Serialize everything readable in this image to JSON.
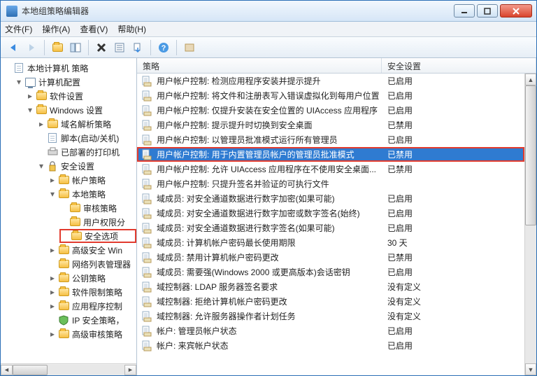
{
  "window": {
    "title": "本地组策略编辑器"
  },
  "menu": {
    "file": "文件(F)",
    "action": "操作(A)",
    "view": "查看(V)",
    "help": "帮助(H)"
  },
  "tree": {
    "root": "本地计算机 策略",
    "computer_config": "计算机配置",
    "software_settings": "软件设置",
    "windows_settings": "Windows 设置",
    "dns_policy": "域名解析策略",
    "scripts": "脚本(启动/关机)",
    "deployed_printers": "已部署的打印机",
    "security_settings": "安全设置",
    "account_policies": "帐户策略",
    "local_policies": "本地策略",
    "audit_policy": "审核策略",
    "user_rights": "用户权限分",
    "security_options": "安全选项",
    "advanced_security_win": "高级安全 Win",
    "network_list_mgr": "网络列表管理器",
    "public_key_policies": "公钥策略",
    "software_restriction": "软件限制策略",
    "app_control_policies": "应用程序控制",
    "ip_security": "IP 安全策略，",
    "advanced_audit": "高级审核策略"
  },
  "columns": {
    "policy": "策略",
    "setting": "安全设置"
  },
  "policies": [
    {
      "name": "用户帐户控制: 检测应用程序安装并提示提升",
      "setting": "已启用"
    },
    {
      "name": "用户帐户控制: 将文件和注册表写入错误虚拟化到每用户位置",
      "setting": "已启用"
    },
    {
      "name": "用户帐户控制: 仅提升安装在安全位置的 UIAccess 应用程序",
      "setting": "已启用"
    },
    {
      "name": "用户帐户控制: 提示提升时切换到安全桌面",
      "setting": "已禁用"
    },
    {
      "name": "用户帐户控制: 以管理员批准模式运行所有管理员",
      "setting": "已启用"
    },
    {
      "name": "用户帐户控制: 用于内置管理员帐户的管理员批准模式",
      "setting": "已禁用",
      "selected": true,
      "highlight": true
    },
    {
      "name": "用户帐户控制: 允许 UIAccess 应用程序在不使用安全桌面...",
      "setting": "已禁用"
    },
    {
      "name": "用户帐户控制: 只提升签名并验证的可执行文件",
      "setting": ""
    },
    {
      "name": "域成员: 对安全通道数据进行数字加密(如果可能)",
      "setting": "已启用"
    },
    {
      "name": "域成员: 对安全通道数据进行数字加密或数字签名(始终)",
      "setting": "已启用"
    },
    {
      "name": "域成员: 对安全通道数据进行数字签名(如果可能)",
      "setting": "已启用"
    },
    {
      "name": "域成员: 计算机帐户密码最长使用期限",
      "setting": "30 天"
    },
    {
      "name": "域成员: 禁用计算机帐户密码更改",
      "setting": "已禁用"
    },
    {
      "name": "域成员: 需要强(Windows 2000 或更高版本)会话密钥",
      "setting": "已启用"
    },
    {
      "name": "域控制器: LDAP 服务器签名要求",
      "setting": "没有定义"
    },
    {
      "name": "域控制器: 拒绝计算机帐户密码更改",
      "setting": "没有定义"
    },
    {
      "name": "域控制器: 允许服务器操作者计划任务",
      "setting": "没有定义"
    },
    {
      "name": "帐户: 管理员帐户状态",
      "setting": "已启用"
    },
    {
      "name": "帐户: 来宾帐户状态",
      "setting": "已启用"
    }
  ]
}
